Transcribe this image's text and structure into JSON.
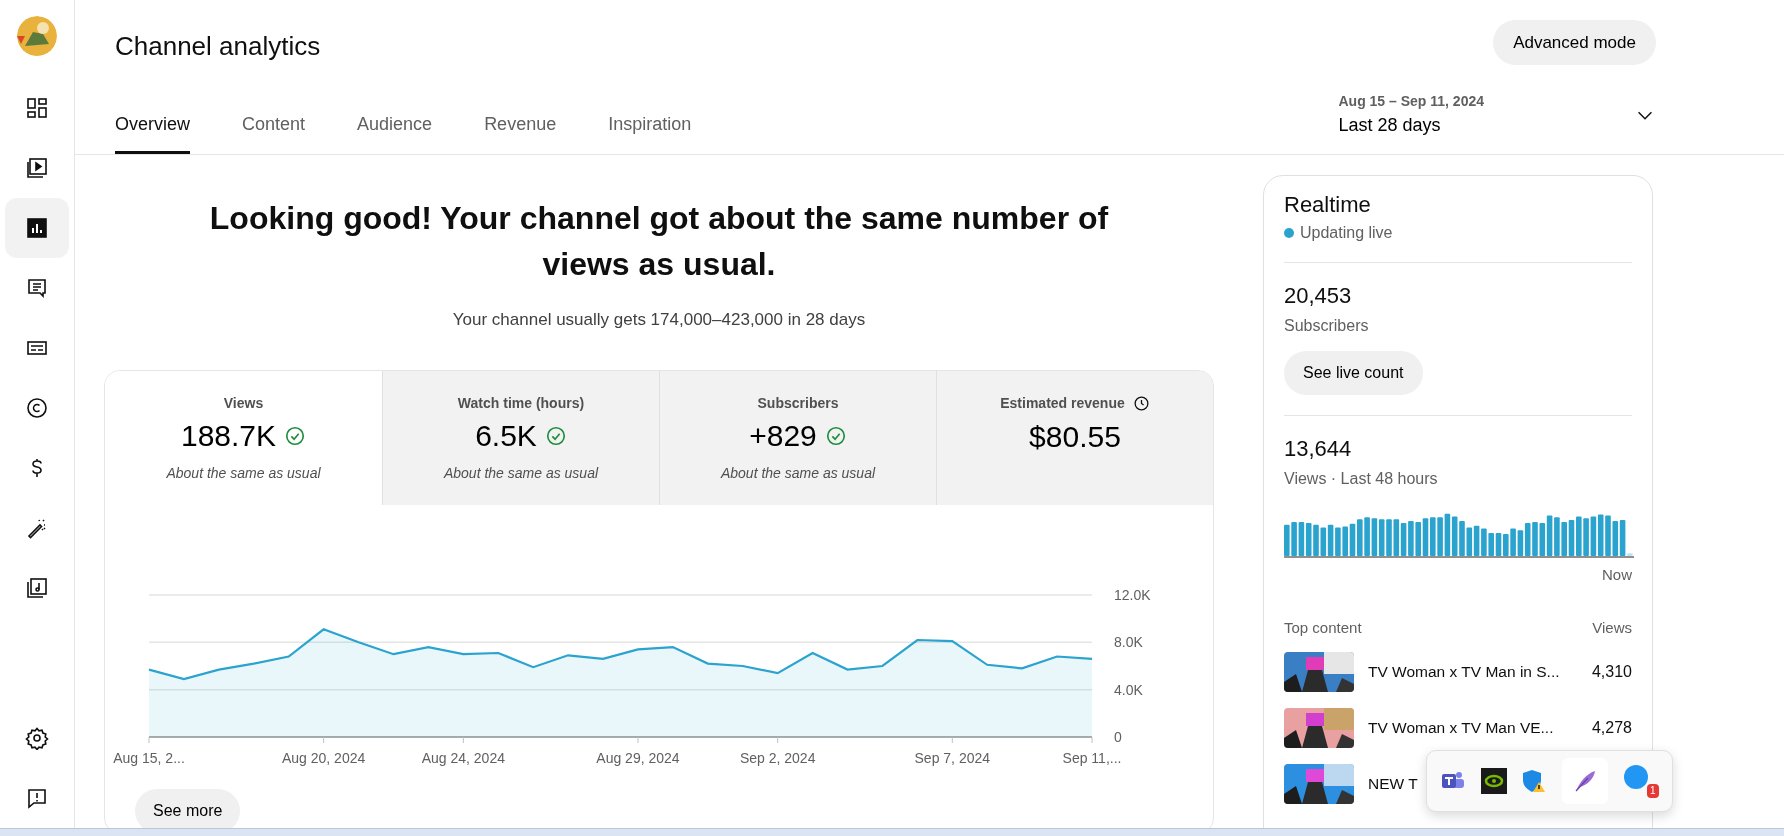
{
  "sidebar": {
    "items": [
      {
        "selected": false
      },
      {
        "selected": false
      },
      {
        "selected": true
      },
      {
        "selected": false
      },
      {
        "selected": false
      },
      {
        "selected": false
      },
      {
        "selected": false
      },
      {
        "selected": false
      },
      {
        "selected": false
      }
    ],
    "bottom_items": [
      {
        "selected": false
      },
      {
        "selected": false
      }
    ]
  },
  "header": {
    "title": "Channel analytics",
    "advanced_button": "Advanced mode",
    "date_range": "Aug 15 – Sep 11, 2024",
    "period": "Last 28 days"
  },
  "tabs": [
    {
      "label": "Overview",
      "selected": true
    },
    {
      "label": "Content",
      "selected": false
    },
    {
      "label": "Audience",
      "selected": false
    },
    {
      "label": "Revenue",
      "selected": false
    },
    {
      "label": "Inspiration",
      "selected": false
    }
  ],
  "headline": "Looking good! Your channel got about the same number of views as usual.",
  "subline": "Your channel usually gets 174,000–423,000 in 28 days",
  "metrics": [
    {
      "kind": "compared",
      "label": "Views",
      "value": "188.7K",
      "note": "About the same as usual",
      "selected": true
    },
    {
      "kind": "compared",
      "label": "Watch time (hours)",
      "value": "6.5K",
      "note": "About the same as usual",
      "selected": false
    },
    {
      "kind": "compared",
      "label": "Subscribers",
      "value": "+829",
      "note": "About the same as usual",
      "selected": false
    },
    {
      "kind": "pending",
      "label": "Estimated revenue",
      "value": "$80.55",
      "selected": false
    }
  ],
  "chart_data": {
    "type": "area",
    "categories": [
      "Aug 15, 2...",
      null,
      null,
      null,
      null,
      "Aug 20, 2024",
      null,
      null,
      null,
      "Aug 24, 2024",
      null,
      null,
      null,
      null,
      "Aug 29, 2024",
      null,
      null,
      null,
      "Sep 2, 2024",
      null,
      null,
      null,
      null,
      "Sep 7, 2024",
      null,
      null,
      null,
      "Sep 11,..."
    ],
    "series": [
      {
        "color": "#2ba3cf",
        "values": [
          5.7,
          4.9,
          5.7,
          6.2,
          6.8,
          9.1,
          8.0,
          7.0,
          7.6,
          7.0,
          7.1,
          5.9,
          6.9,
          6.6,
          7.4,
          7.6,
          6.2,
          6.0,
          5.4,
          7.1,
          5.7,
          6.0,
          8.2,
          8.1,
          6.1,
          5.8,
          6.8,
          6.6
        ]
      }
    ],
    "ylim": [
      0,
      12
    ],
    "yticks": [
      {
        "value": 0,
        "label": "0"
      },
      {
        "value": 4,
        "label": "4.0K"
      },
      {
        "value": 8,
        "label": "8.0K"
      },
      {
        "value": 12,
        "label": "12.0K"
      }
    ]
  },
  "see_more": "See more",
  "realtime": {
    "title": "Realtime",
    "status": "Updating live",
    "subscribers": "20,453",
    "subscribers_label": "Subscribers",
    "live_button": "See live count",
    "views": "13,644",
    "views_label": "Views · Last 48 hours",
    "now_label": "Now",
    "top_label": "Top content",
    "views_column": "Views",
    "top_content": [
      {
        "title": "TV Woman x TV Man in S...",
        "views": "4,310"
      },
      {
        "title": "TV Woman x TV Man VE...",
        "views": "4,278"
      },
      {
        "title": "NEW T"
      }
    ]
  },
  "tray": {
    "badge": "1"
  }
}
